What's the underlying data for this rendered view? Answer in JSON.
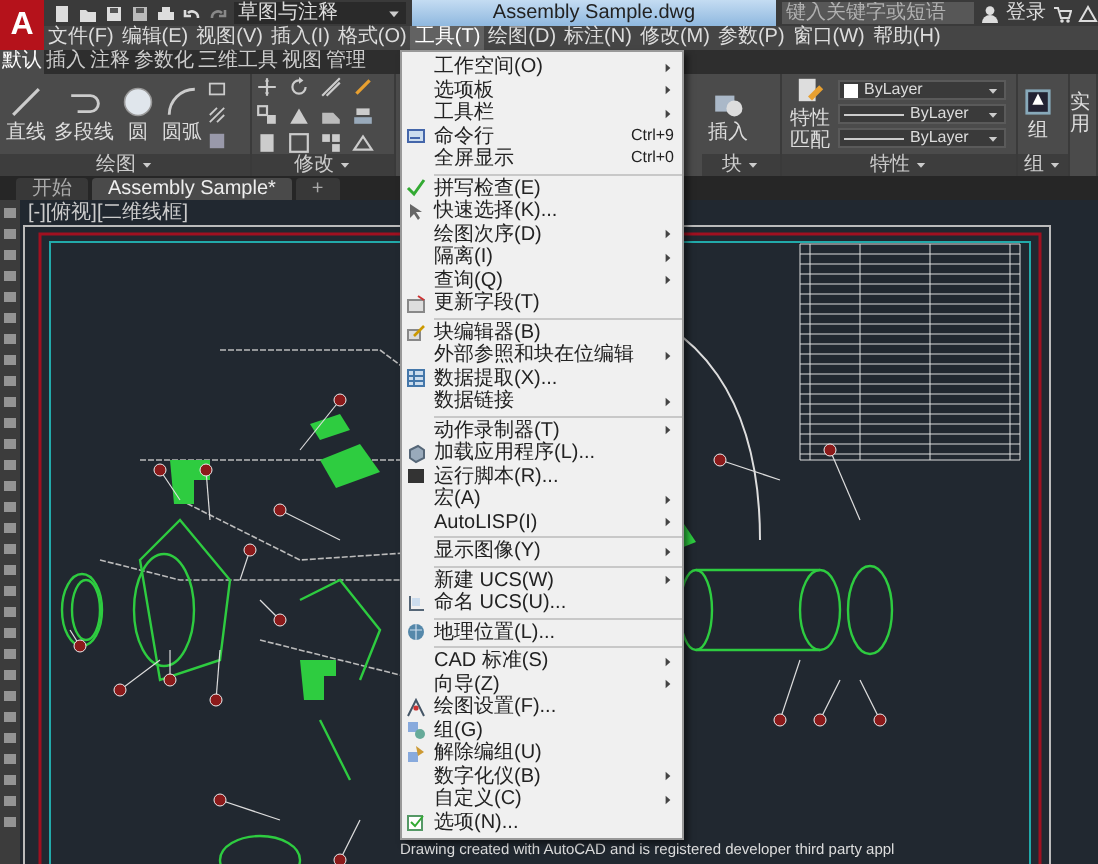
{
  "title_bar": {
    "app_logo": "A",
    "workspace": "草图与注释",
    "document_title": "Assembly Sample.dwg",
    "search": {
      "placeholder": "键入关键字或短语"
    },
    "user": "登录"
  },
  "menu_bar": [
    {
      "label": "文件(F)",
      "selected": false
    },
    {
      "label": "编辑(E)",
      "selected": false
    },
    {
      "label": "视图(V)",
      "selected": false
    },
    {
      "label": "插入(I)",
      "selected": false
    },
    {
      "label": "格式(O)",
      "selected": false
    },
    {
      "label": "工具(T)",
      "selected": true
    },
    {
      "label": "绘图(D)",
      "selected": false
    },
    {
      "label": "标注(N)",
      "selected": false
    },
    {
      "label": "修改(M)",
      "selected": false
    },
    {
      "label": "参数(P)",
      "selected": false
    },
    {
      "label": "窗口(W)",
      "selected": false
    },
    {
      "label": "帮助(H)",
      "selected": false
    }
  ],
  "ribbon": {
    "tabs": [
      {
        "label": "默认",
        "selected": true
      },
      {
        "label": "插入",
        "selected": false
      },
      {
        "label": "注释",
        "selected": false
      },
      {
        "label": "参数化",
        "selected": false
      },
      {
        "label": "三维工具",
        "selected": false
      },
      {
        "label": "视图",
        "selected": false
      },
      {
        "label": "管理",
        "selected": false
      }
    ],
    "draw_panel": {
      "tools": [
        "直线",
        "多段线",
        "圆",
        "圆弧"
      ],
      "label": "绘图"
    },
    "modify_panel": {
      "label": "修改"
    },
    "block_panel": {
      "insert": "插入",
      "label": "块"
    },
    "properties_panel": {
      "match": "特性匹配",
      "values": [
        "ByLayer",
        "ByLayer",
        "ByLayer"
      ],
      "label": "特性"
    },
    "groups_panel": {
      "group": "组",
      "label": "组"
    },
    "utilities": "实用"
  },
  "document_tabs": [
    {
      "label": "开始",
      "selected": false
    },
    {
      "label": "Assembly Sample*",
      "selected": true
    }
  ],
  "new_tab": "+",
  "viewport": {
    "label": "[-][俯视][二维线框]",
    "footer": "Drawing created with AutoCAD and is registered developer third party appl"
  },
  "tools_menu": {
    "groups": [
      [
        {
          "label": "工作空间(O)",
          "icon": false,
          "submenu": true
        },
        {
          "label": "选项板",
          "icon": false,
          "submenu": true
        },
        {
          "label": "工具栏",
          "icon": false,
          "submenu": true
        },
        {
          "label": "命令行",
          "icon": true,
          "submenu": false,
          "shortcut": "Ctrl+9"
        },
        {
          "label": "全屏显示",
          "icon": false,
          "submenu": false,
          "shortcut": "Ctrl+0"
        }
      ],
      [
        {
          "label": "拼写检查(E)",
          "icon": true,
          "submenu": false
        },
        {
          "label": "快速选择(K)...",
          "icon": true,
          "submenu": false
        },
        {
          "label": "绘图次序(D)",
          "icon": false,
          "submenu": true
        },
        {
          "label": "隔离(I)",
          "icon": false,
          "submenu": true
        },
        {
          "label": "查询(Q)",
          "icon": false,
          "submenu": true
        },
        {
          "label": "更新字段(T)",
          "icon": true,
          "submenu": false
        }
      ],
      [
        {
          "label": "块编辑器(B)",
          "icon": true,
          "submenu": false
        },
        {
          "label": "外部参照和块在位编辑",
          "icon": false,
          "submenu": true
        },
        {
          "label": "数据提取(X)...",
          "icon": true,
          "submenu": false
        },
        {
          "label": "数据链接",
          "icon": false,
          "submenu": true
        }
      ],
      [
        {
          "label": "动作录制器(T)",
          "icon": false,
          "submenu": true
        },
        {
          "label": "加载应用程序(L)...",
          "icon": true,
          "submenu": false
        },
        {
          "label": "运行脚本(R)...",
          "icon": true,
          "submenu": false
        },
        {
          "label": "宏(A)",
          "icon": false,
          "submenu": true
        },
        {
          "label": "AutoLISP(I)",
          "icon": false,
          "submenu": true
        }
      ],
      [
        {
          "label": "显示图像(Y)",
          "icon": false,
          "submenu": true
        }
      ],
      [
        {
          "label": "新建 UCS(W)",
          "icon": false,
          "submenu": true
        },
        {
          "label": "命名 UCS(U)...",
          "icon": true,
          "submenu": false
        }
      ],
      [
        {
          "label": "地理位置(L)...",
          "icon": true,
          "submenu": false
        }
      ],
      [
        {
          "label": "CAD 标准(S)",
          "icon": false,
          "submenu": true
        },
        {
          "label": "向导(Z)",
          "icon": false,
          "submenu": true
        },
        {
          "label": "绘图设置(F)...",
          "icon": true,
          "submenu": false
        },
        {
          "label": "组(G)",
          "icon": true,
          "submenu": false
        },
        {
          "label": "解除编组(U)",
          "icon": true,
          "submenu": false
        },
        {
          "label": "数字化仪(B)",
          "icon": false,
          "submenu": true
        },
        {
          "label": "自定义(C)",
          "icon": false,
          "submenu": true
        },
        {
          "label": "选项(N)...",
          "icon": true,
          "submenu": false
        }
      ]
    ]
  }
}
